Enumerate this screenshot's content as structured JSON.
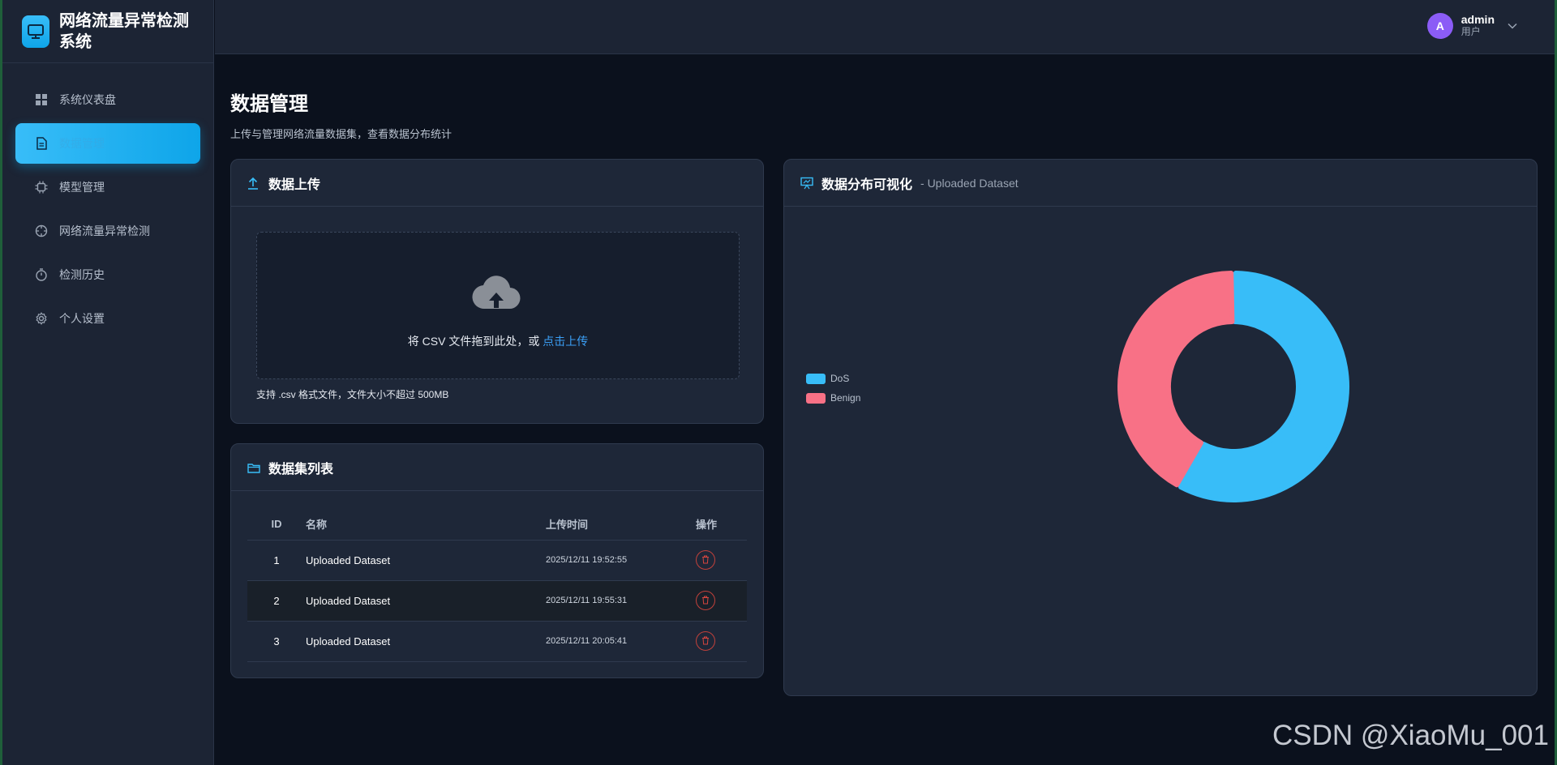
{
  "brand": {
    "title": "网络流量异常检测系统"
  },
  "sidebar": {
    "items": [
      {
        "label": "系统仪表盘",
        "icon": "dashboard-icon"
      },
      {
        "label": "数据管理",
        "icon": "document-icon",
        "active": true
      },
      {
        "label": "模型管理",
        "icon": "chip-icon"
      },
      {
        "label": "网络流量异常检测",
        "icon": "crosshair-icon"
      },
      {
        "label": "检测历史",
        "icon": "stopwatch-icon"
      },
      {
        "label": "个人设置",
        "icon": "gear-icon"
      }
    ]
  },
  "header": {
    "user": {
      "initial": "A",
      "name": "admin",
      "role": "用户"
    }
  },
  "page": {
    "title": "数据管理",
    "subtitle": "上传与管理网络流量数据集，查看数据分布统计"
  },
  "upload": {
    "title": "数据上传",
    "drop_text": "将 CSV 文件拖到此处，或 ",
    "drop_link": "点击上传",
    "tip": "支持 .csv 格式文件，文件大小不超过 500MB"
  },
  "datasets": {
    "title": "数据集列表",
    "columns": {
      "id": "ID",
      "name": "名称",
      "time": "上传时间",
      "op": "操作"
    },
    "rows": [
      {
        "id": "1",
        "name": "Uploaded Dataset",
        "time": "2025/12/11 19:52:55"
      },
      {
        "id": "2",
        "name": "Uploaded Dataset",
        "time": "2025/12/11 19:55:31"
      },
      {
        "id": "3",
        "name": "Uploaded Dataset",
        "time": "2025/12/11 20:05:41"
      }
    ]
  },
  "chart": {
    "title": "数据分布可视化",
    "subtitle": "- Uploaded Dataset"
  },
  "chart_data": {
    "type": "pie",
    "donut": true,
    "legend_position": "left",
    "series": [
      {
        "name": "DoS",
        "value": 58,
        "color": "#38bdf8"
      },
      {
        "name": "Benign",
        "value": 42,
        "color": "#f87186"
      }
    ]
  },
  "watermark": "CSDN @XiaoMu_001",
  "colors": {
    "accent": "#0ea5e9",
    "danger": "#c2413b",
    "avatar": "#8b5cf6"
  }
}
